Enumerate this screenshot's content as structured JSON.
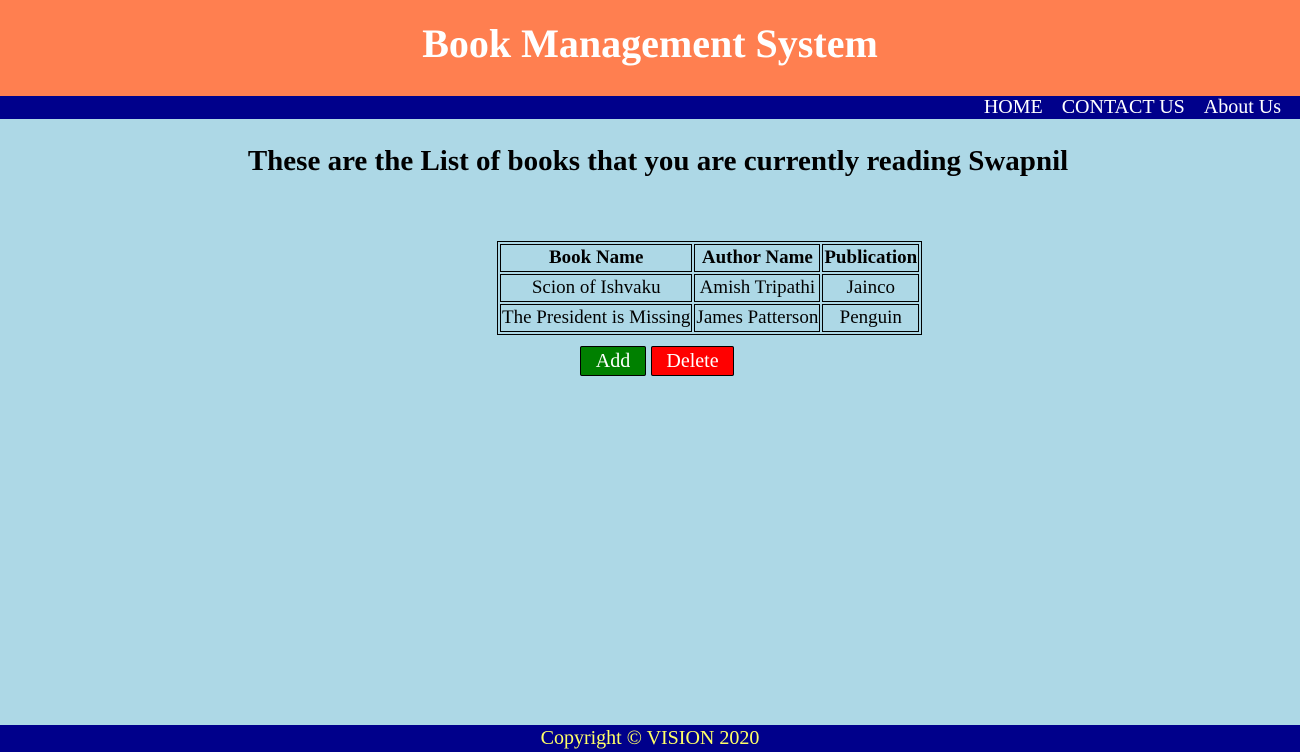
{
  "header": {
    "title": "Book Management System"
  },
  "nav": {
    "items": [
      {
        "label": "HOME"
      },
      {
        "label": "CONTACT US"
      },
      {
        "label": "About Us"
      }
    ]
  },
  "main": {
    "heading": "These are the List of books that you are currently reading Swapnil",
    "table": {
      "columns": [
        "Book Name",
        "Author Name",
        "Publication"
      ],
      "rows": [
        [
          "Scion of Ishvaku",
          "Amish Tripathi",
          "Jainco"
        ],
        [
          "The President is Missing",
          "James Patterson",
          "Penguin"
        ]
      ]
    },
    "buttons": {
      "add": "Add",
      "delete": "Delete"
    }
  },
  "footer": {
    "text": "Copyright © VISION 2020"
  },
  "colors": {
    "header_bg": "#ff7f50",
    "nav_bg": "#00008b",
    "page_bg": "#add8e6",
    "add_bg": "#008000",
    "delete_bg": "#ff0000",
    "footer_text": "#ffff66"
  }
}
